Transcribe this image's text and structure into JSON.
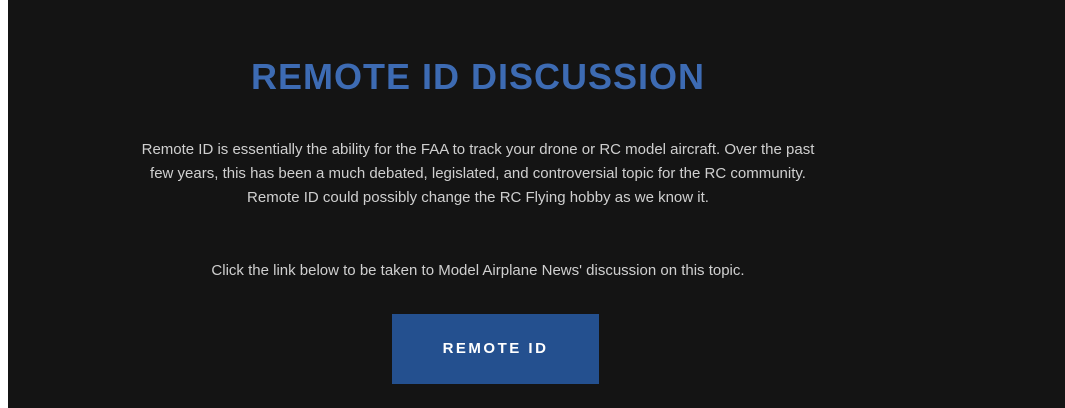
{
  "section": {
    "title": "REMOTE ID DISCUSSION",
    "description_lines": [
      "Remote ID is essentially the ability for the FAA to track your drone or RC model aircraft. Over the past",
      "few years, this has been a much debated, legislated, and controversial topic for the RC community.",
      "Remote ID could possibly change the RC Flying hobby as we know it."
    ],
    "cta_text": "Click the link below to be taken to Model Airplane News' discussion on this topic.",
    "button_label": "REMOTE ID"
  },
  "colors": {
    "background": "#141414",
    "title": "#3d6bb3",
    "body_text": "#cfcfcf",
    "button_bg": "#24508f",
    "button_text": "#ffffff"
  }
}
